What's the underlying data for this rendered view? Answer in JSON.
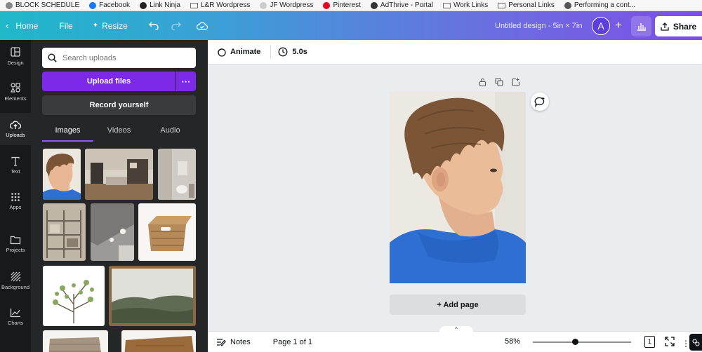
{
  "bookmarks": [
    {
      "label": "BLOCK SCHEDULE",
      "icon": "page-icon",
      "color": "#888888"
    },
    {
      "label": "Facebook",
      "icon": "facebook-icon",
      "color": "#1877f2"
    },
    {
      "label": "Link Ninja",
      "icon": "globe-icon",
      "color": "#222222"
    },
    {
      "label": "L&R Wordpress",
      "icon": "folder-icon",
      "color": "#666666"
    },
    {
      "label": "JF Wordpress",
      "icon": "dot-icon",
      "color": "#cccccc"
    },
    {
      "label": "Pinterest",
      "icon": "pinterest-icon",
      "color": "#e60023"
    },
    {
      "label": "AdThrive - Portal",
      "icon": "adthrive-icon",
      "color": "#333333"
    },
    {
      "label": "Work Links",
      "icon": "folder-icon",
      "color": "#666666"
    },
    {
      "label": "Personal Links",
      "icon": "folder-icon",
      "color": "#666666"
    },
    {
      "label": "Performing a cont...",
      "icon": "performing-icon",
      "color": "#555555"
    }
  ],
  "topbar": {
    "home_label": "Home",
    "file_label": "File",
    "resize_label": "Resize",
    "doc_title": "Untitled design - 5in × 7in",
    "avatar_letter": "A",
    "share_label": "Share"
  },
  "rail": [
    {
      "label": "Design",
      "icon": "design-icon",
      "active": false
    },
    {
      "label": "Elements",
      "icon": "elements-icon",
      "active": false
    },
    {
      "label": "Uploads",
      "icon": "uploads-icon",
      "active": true
    },
    {
      "label": "Text",
      "icon": "text-icon",
      "active": false
    },
    {
      "label": "Apps",
      "icon": "apps-icon",
      "active": false
    },
    {
      "label": "Projects",
      "icon": "projects-icon",
      "active": false
    },
    {
      "label": "Background",
      "icon": "background-icon",
      "active": false
    },
    {
      "label": "Charts",
      "icon": "charts-icon",
      "active": false
    }
  ],
  "panel": {
    "search_placeholder": "Search uploads",
    "upload_label": "Upload files",
    "record_label": "Record yourself",
    "tabs": [
      "Images",
      "Videos",
      "Audio"
    ],
    "active_tab": "Images"
  },
  "context_bar": {
    "animate_label": "Animate",
    "duration": "5.0s"
  },
  "canvas": {
    "add_page_label": "+ Add page"
  },
  "footer": {
    "notes_label": "Notes",
    "page_indicator": "Page 1 of 1",
    "zoom": "58%",
    "zoom_fraction": 0.43,
    "page_count": "1"
  },
  "colors": {
    "brand_purple": "#7d2ae8",
    "rail_bg": "#18191b",
    "panel_bg": "#252627"
  }
}
